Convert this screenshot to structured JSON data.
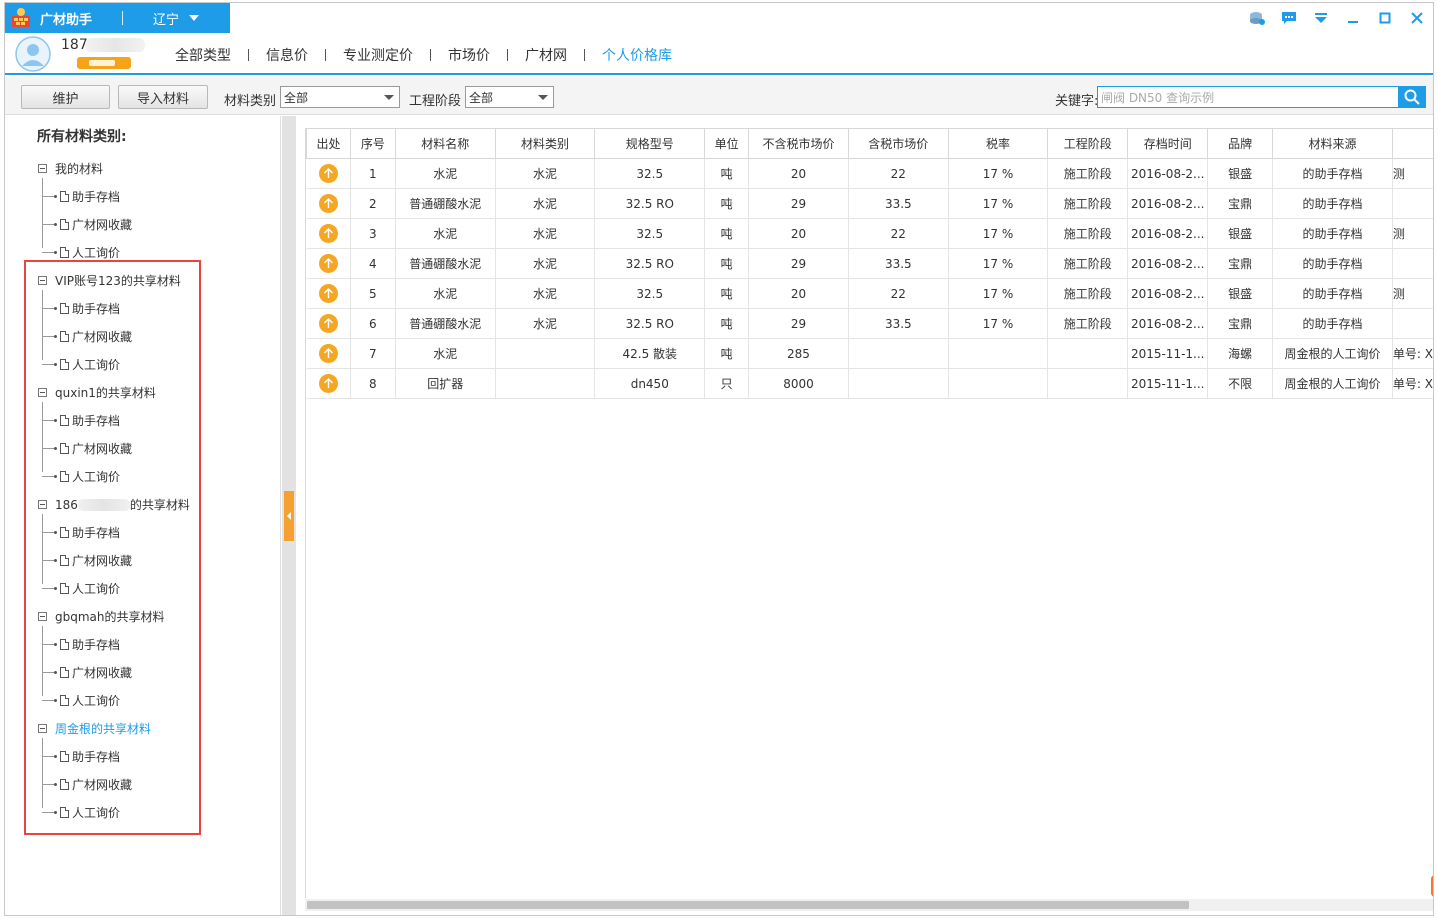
{
  "app": {
    "name": "广材助手",
    "region": "辽宁",
    "colors": {
      "primary": "#1e9ce8",
      "accent": "#f5a623",
      "highlight": "#e8453c"
    }
  },
  "window_controls": [
    {
      "name": "skin-icon"
    },
    {
      "name": "message-icon"
    },
    {
      "name": "menu-dropdown-icon"
    },
    {
      "name": "minimize-icon"
    },
    {
      "name": "maximize-icon"
    },
    {
      "name": "close-icon"
    }
  ],
  "user": {
    "name": "187"
  },
  "nav": {
    "items": [
      "全部类型",
      "信息价",
      "专业测定价",
      "市场价",
      "广材网",
      "个人价格库"
    ],
    "active_index": 5
  },
  "toolbar": {
    "maintain_label": "维护",
    "import_label": "导入材料",
    "category_label": "材料类别",
    "category_value": "全部",
    "stage_label": "工程阶段",
    "stage_value": "全部",
    "keyword_label": "关键字:",
    "search_placeholder": "闸阀 DN50 查询示例"
  },
  "sidebar": {
    "title": "所有材料类别:",
    "groups": [
      {
        "label": "我的材料",
        "children": [
          "助手存档",
          "广材网收藏",
          "人工询价"
        ]
      },
      {
        "label": "VIP账号123的共享材料",
        "children": [
          "助手存档",
          "广材网收藏",
          "人工询价"
        ]
      },
      {
        "label": "quxin1的共享材料",
        "children": [
          "助手存档",
          "广材网收藏",
          "人工询价"
        ]
      },
      {
        "label_prefix": "186",
        "label_suffix": "的共享材料",
        "children": [
          "助手存档",
          "广材网收藏",
          "人工询价"
        ]
      },
      {
        "label": "gbqmah的共享材料",
        "children": [
          "助手存档",
          "广材网收藏",
          "人工询价"
        ]
      },
      {
        "label": "周金根的共享材料",
        "children": [
          "助手存档",
          "广材网收藏",
          "人工询价"
        ],
        "selected": true
      }
    ]
  },
  "table": {
    "columns": [
      "出处",
      "序号",
      "材料名称",
      "材料类别",
      "规格型号",
      "单位",
      "不含税市场价",
      "含税市场价",
      "税率",
      "工程阶段",
      "存档时间",
      "品牌",
      "材料来源",
      ""
    ],
    "rows": [
      [
        "",
        "1",
        "水泥",
        "水泥",
        "32.5",
        "吨",
        "20",
        "22",
        "17 %",
        "施工阶段",
        "2016-08-2...",
        "银盛",
        "的助手存档",
        "测"
      ],
      [
        "",
        "2",
        "普通硼酸水泥",
        "水泥",
        "32.5 RO",
        "吨",
        "29",
        "33.5",
        "17 %",
        "施工阶段",
        "2016-08-2...",
        "宝鼎",
        "的助手存档",
        ""
      ],
      [
        "",
        "3",
        "水泥",
        "水泥",
        "32.5",
        "吨",
        "20",
        "22",
        "17 %",
        "施工阶段",
        "2016-08-2...",
        "银盛",
        "的助手存档",
        "测"
      ],
      [
        "",
        "4",
        "普通硼酸水泥",
        "水泥",
        "32.5 RO",
        "吨",
        "29",
        "33.5",
        "17 %",
        "施工阶段",
        "2016-08-2...",
        "宝鼎",
        "的助手存档",
        ""
      ],
      [
        "",
        "5",
        "水泥",
        "水泥",
        "32.5",
        "吨",
        "20",
        "22",
        "17 %",
        "施工阶段",
        "2016-08-2...",
        "银盛",
        "的助手存档",
        "测"
      ],
      [
        "",
        "6",
        "普通硼酸水泥",
        "水泥",
        "32.5 RO",
        "吨",
        "29",
        "33.5",
        "17 %",
        "施工阶段",
        "2016-08-2...",
        "宝鼎",
        "的助手存档",
        ""
      ],
      [
        "",
        "7",
        "水泥",
        "",
        "42.5 散装",
        "吨",
        "285",
        "",
        "",
        "",
        "2015-11-1...",
        "海螺",
        "周金根的人工询价",
        "单号: X"
      ],
      [
        "",
        "8",
        "回扩器",
        "",
        "dn450",
        "只",
        "8000",
        "",
        "",
        "",
        "2015-11-1...",
        "不限",
        "周金根的人工询价",
        "单号: X"
      ]
    ]
  }
}
